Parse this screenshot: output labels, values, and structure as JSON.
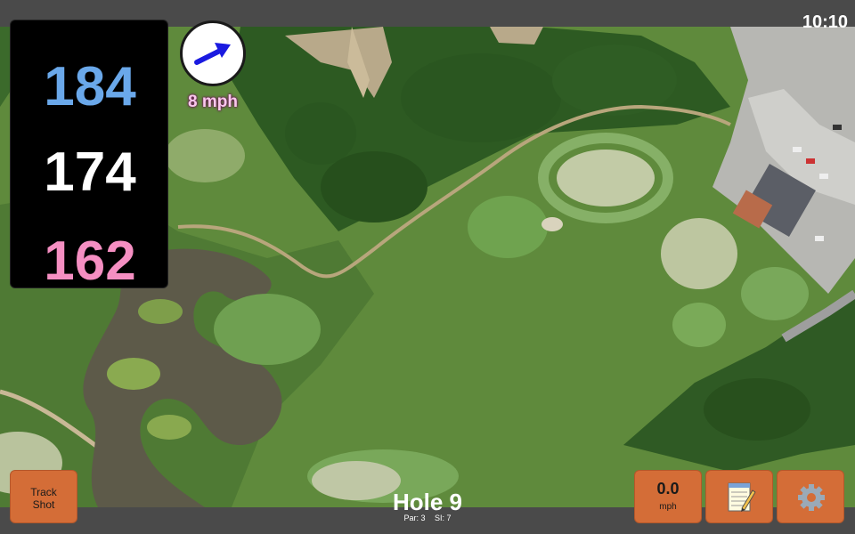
{
  "status_bar": {
    "time": "10:10"
  },
  "distances": {
    "back": "184",
    "middle": "174",
    "front": "162"
  },
  "wind": {
    "speed_label": "8 mph",
    "direction_icon": "wind-arrow-icon"
  },
  "hole": {
    "title": "Hole 9",
    "par_label": "Par: 3",
    "si_label": "SI: 7"
  },
  "buttons": {
    "track_shot_line1": "Track",
    "track_shot_line2": "Shot",
    "speed_value": "0.0",
    "speed_unit": "mph",
    "notes_icon": "notepad-icon",
    "settings_icon": "gear-icon"
  },
  "colors": {
    "back_distance": "#6aa8ea",
    "middle_distance": "#ffffff",
    "front_distance": "#f58fc2",
    "button": "#d46d37",
    "bar": "#4a4a4a"
  }
}
